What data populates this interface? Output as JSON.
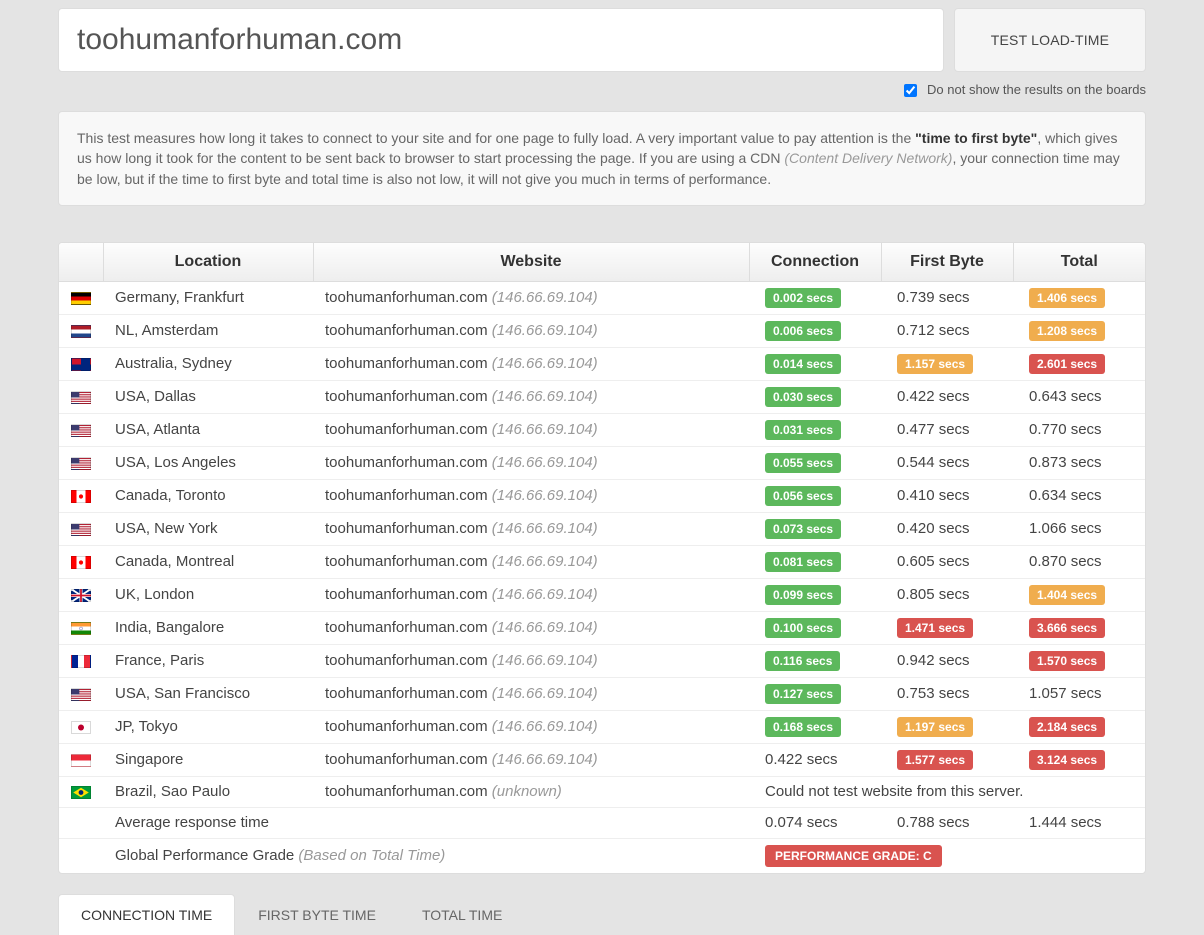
{
  "url_value": "toohumanforhuman.com",
  "test_button": "TEST LOAD-TIME",
  "noboards_label": "Do not show the results on the boards",
  "info": {
    "part1": "This test measures how long it takes to connect to your site and for one page to fully load. A very important value to pay attention is the ",
    "bold": "\"time to first byte\"",
    "part2": ", which gives us how long it took for the content to be sent back to browser to start processing the page. If you are using a CDN ",
    "cdn": "(Content Delivery Network)",
    "part3": ", your connection time may be low, but if the time to first byte and total time is also not low, it will not give you much in terms of performance."
  },
  "headers": {
    "location": "Location",
    "website": "Website",
    "connection": "Connection",
    "firstbyte": "First Byte",
    "total": "Total"
  },
  "rows": [
    {
      "flag": "de",
      "location": "Germany, Frankfurt",
      "site": "toohumanforhuman.com",
      "ip": "(146.66.69.104)",
      "conn": "0.002 secs",
      "conn_c": "green",
      "fb": "0.739 secs",
      "fb_c": "",
      "tot": "1.406 secs",
      "tot_c": "orange"
    },
    {
      "flag": "nl",
      "location": "NL, Amsterdam",
      "site": "toohumanforhuman.com",
      "ip": "(146.66.69.104)",
      "conn": "0.006 secs",
      "conn_c": "green",
      "fb": "0.712 secs",
      "fb_c": "",
      "tot": "1.208 secs",
      "tot_c": "orange"
    },
    {
      "flag": "au",
      "location": "Australia, Sydney",
      "site": "toohumanforhuman.com",
      "ip": "(146.66.69.104)",
      "conn": "0.014 secs",
      "conn_c": "green",
      "fb": "1.157 secs",
      "fb_c": "orange",
      "tot": "2.601 secs",
      "tot_c": "red"
    },
    {
      "flag": "us",
      "location": "USA, Dallas",
      "site": "toohumanforhuman.com",
      "ip": "(146.66.69.104)",
      "conn": "0.030 secs",
      "conn_c": "green",
      "fb": "0.422 secs",
      "fb_c": "",
      "tot": "0.643 secs",
      "tot_c": ""
    },
    {
      "flag": "us",
      "location": "USA, Atlanta",
      "site": "toohumanforhuman.com",
      "ip": "(146.66.69.104)",
      "conn": "0.031 secs",
      "conn_c": "green",
      "fb": "0.477 secs",
      "fb_c": "",
      "tot": "0.770 secs",
      "tot_c": ""
    },
    {
      "flag": "us",
      "location": "USA, Los Angeles",
      "site": "toohumanforhuman.com",
      "ip": "(146.66.69.104)",
      "conn": "0.055 secs",
      "conn_c": "green",
      "fb": "0.544 secs",
      "fb_c": "",
      "tot": "0.873 secs",
      "tot_c": ""
    },
    {
      "flag": "ca",
      "location": "Canada, Toronto",
      "site": "toohumanforhuman.com",
      "ip": "(146.66.69.104)",
      "conn": "0.056 secs",
      "conn_c": "green",
      "fb": "0.410 secs",
      "fb_c": "",
      "tot": "0.634 secs",
      "tot_c": ""
    },
    {
      "flag": "us",
      "location": "USA, New York",
      "site": "toohumanforhuman.com",
      "ip": "(146.66.69.104)",
      "conn": "0.073 secs",
      "conn_c": "green",
      "fb": "0.420 secs",
      "fb_c": "",
      "tot": "1.066 secs",
      "tot_c": ""
    },
    {
      "flag": "ca",
      "location": "Canada, Montreal",
      "site": "toohumanforhuman.com",
      "ip": "(146.66.69.104)",
      "conn": "0.081 secs",
      "conn_c": "green",
      "fb": "0.605 secs",
      "fb_c": "",
      "tot": "0.870 secs",
      "tot_c": ""
    },
    {
      "flag": "gb",
      "location": "UK, London",
      "site": "toohumanforhuman.com",
      "ip": "(146.66.69.104)",
      "conn": "0.099 secs",
      "conn_c": "green",
      "fb": "0.805 secs",
      "fb_c": "",
      "tot": "1.404 secs",
      "tot_c": "orange"
    },
    {
      "flag": "in",
      "location": "India, Bangalore",
      "site": "toohumanforhuman.com",
      "ip": "(146.66.69.104)",
      "conn": "0.100 secs",
      "conn_c": "green",
      "fb": "1.471 secs",
      "fb_c": "red",
      "tot": "3.666 secs",
      "tot_c": "red"
    },
    {
      "flag": "fr",
      "location": "France, Paris",
      "site": "toohumanforhuman.com",
      "ip": "(146.66.69.104)",
      "conn": "0.116 secs",
      "conn_c": "green",
      "fb": "0.942 secs",
      "fb_c": "",
      "tot": "1.570 secs",
      "tot_c": "red"
    },
    {
      "flag": "us",
      "location": "USA, San Francisco",
      "site": "toohumanforhuman.com",
      "ip": "(146.66.69.104)",
      "conn": "0.127 secs",
      "conn_c": "green",
      "fb": "0.753 secs",
      "fb_c": "",
      "tot": "1.057 secs",
      "tot_c": ""
    },
    {
      "flag": "jp",
      "location": "JP, Tokyo",
      "site": "toohumanforhuman.com",
      "ip": "(146.66.69.104)",
      "conn": "0.168 secs",
      "conn_c": "green",
      "fb": "1.197 secs",
      "fb_c": "orange",
      "tot": "2.184 secs",
      "tot_c": "red"
    },
    {
      "flag": "sg",
      "location": "Singapore",
      "site": "toohumanforhuman.com",
      "ip": "(146.66.69.104)",
      "conn": "0.422 secs",
      "conn_c": "",
      "fb": "1.577 secs",
      "fb_c": "red",
      "tot": "3.124 secs",
      "tot_c": "red"
    },
    {
      "flag": "br",
      "location": "Brazil, Sao Paulo",
      "site": "toohumanforhuman.com",
      "ip": "(unknown)",
      "error": "Could not test website from this server."
    }
  ],
  "avg": {
    "label": "Average response time",
    "conn": "0.074 secs",
    "fb": "0.788 secs",
    "tot": "1.444 secs"
  },
  "grade": {
    "label": "Global Performance Grade",
    "note": "(Based on Total Time)",
    "badge": "PERFORMANCE GRADE:  C"
  },
  "tabs": {
    "connection": "CONNECTION TIME",
    "firstbyte": "FIRST BYTE TIME",
    "total": "TOTAL TIME"
  }
}
